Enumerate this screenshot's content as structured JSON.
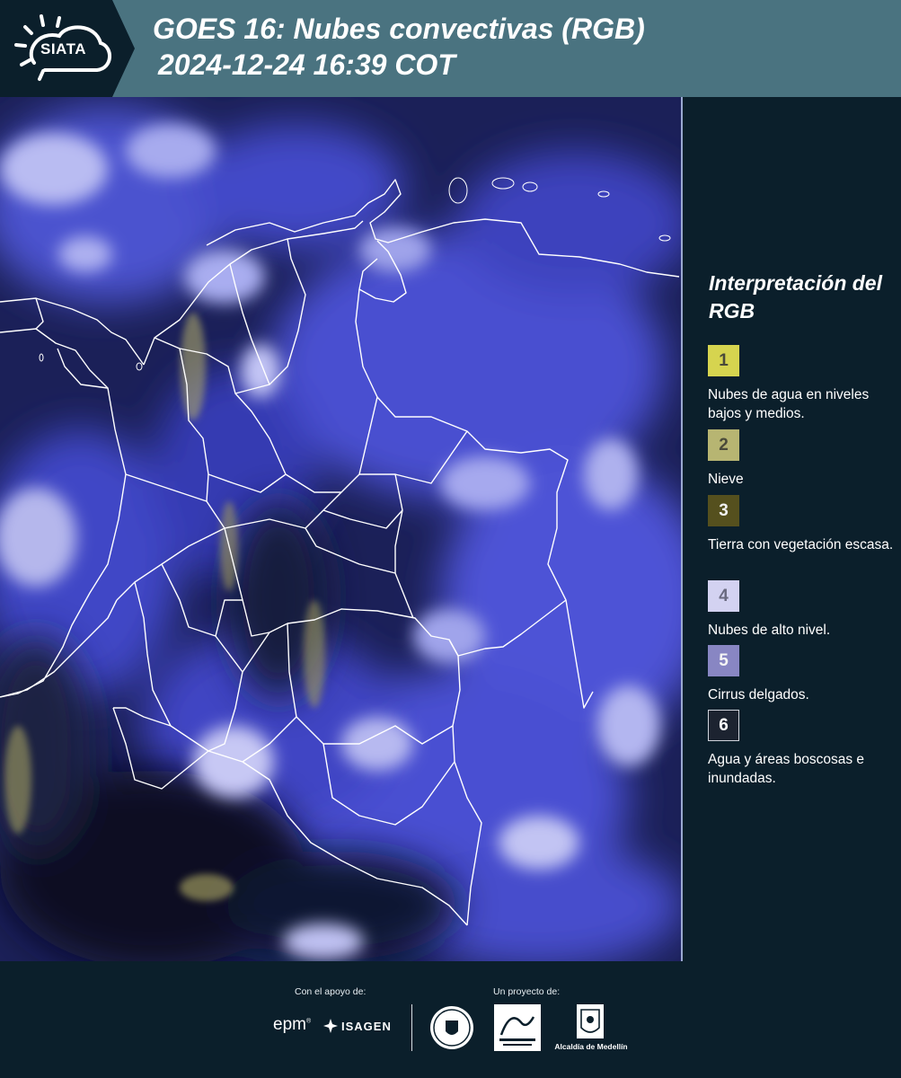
{
  "header": {
    "logo_text": "SIATA",
    "title_line1": "GOES 16: Nubes convectivas (RGB)",
    "title_line2": "2024-12-24 16:39 COT"
  },
  "legend": {
    "title": "Interpretación del RGB",
    "items": [
      {
        "number": "1",
        "color": "#d6d44f",
        "text_color": "#4a4a3a",
        "description": "Nubes de agua en niveles bajos y medios."
      },
      {
        "number": "2",
        "color": "#b7b572",
        "text_color": "#4a4a3a",
        "description": "Nieve"
      },
      {
        "number": "3",
        "color": "#55501e",
        "text_color": "#f0f0f0",
        "description": "Tierra con vegetación escasa."
      },
      {
        "number": "4",
        "color": "#d3d2f1",
        "text_color": "#6a6a80",
        "description": "Nubes de alto nivel."
      },
      {
        "number": "5",
        "color": "#8886c3",
        "text_color": "#f5f5f5",
        "description": "Cirrus delgados."
      },
      {
        "number": "6",
        "color": "#1c2330",
        "text_color": "#ffffff",
        "description": "Agua y áreas boscosas e inundadas."
      }
    ]
  },
  "footer": {
    "support_label": "Con el apoyo de:",
    "project_label": "Un proyecto de:",
    "epm_logo": "epm",
    "isagen_logo": "ISAGEN",
    "alcaldia_logo": "Alcaldía de Medellín"
  },
  "colors": {
    "header_bg": "#4a7380",
    "panel_bg": "#0b1f2b",
    "cloud_high": "#c9c9f3",
    "cloud_mid": "#5a5ee0",
    "land_dark": "#111628",
    "low_cloud_yellow": "#c8c36a"
  }
}
